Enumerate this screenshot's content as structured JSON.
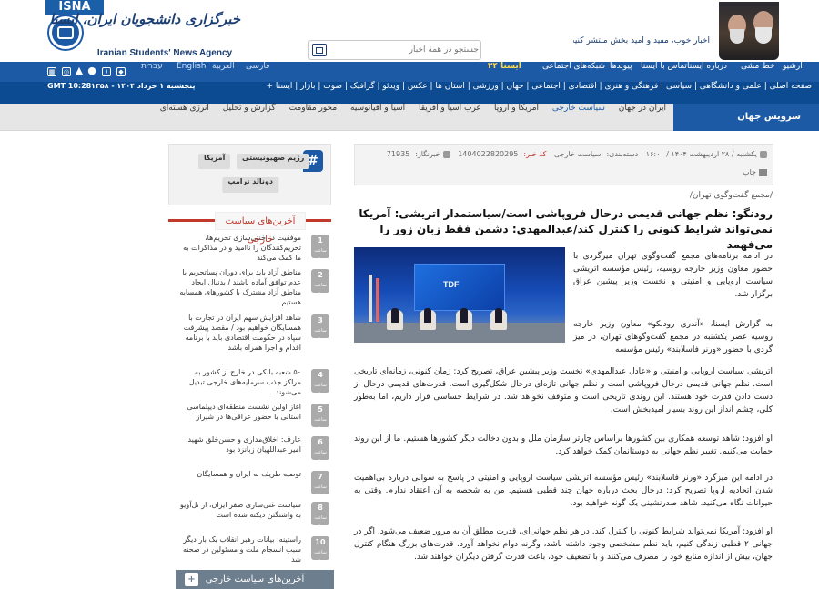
{
  "header": {
    "isna_label": "ISNA",
    "brand_fa": "خبرگزاری دانشجویان ایران، ایسنا",
    "brand_en": "Iranian Students' News Agency",
    "search_placeholder": "جستجو در همهٔ اخبار",
    "leader_text": "اخبار خوب، مفید و امید بخش منتشر کنید. رهبر معظم انقلاب"
  },
  "topnav": {
    "items": [
      "آرشیو",
      "خط مشی",
      "درباره ایسنا",
      "تماس با ایسنا",
      "پیوندها",
      "شبکه‌های اجتماعی"
    ],
    "isna24": "ایسنا ۲۴",
    "languages": [
      "فارسی",
      "العربية",
      "English",
      "עברית"
    ]
  },
  "subnav": {
    "links": "صفحه اصلی | علمی و دانشگاهی | سیاسی | فرهنگی و هنری | اقتصادی | اجتماعی | جهان | ورزشی | استان ها | عکس | ویدئو | گرافیک | صوت | بازار | ایسنا +",
    "date": "پنجشنبه ۱ خرداد ۱۴۰۴ - ۱۳۵۸",
    "gmt": "GMT 10:28"
  },
  "sectionbar": {
    "title": "سرویس جهان",
    "links": [
      "ایران در جهان",
      "سیاست خارجی",
      "آمریکا و اروپا",
      "غرب آسیا و آفریقا",
      "آسیا و اقیانوسیه",
      "محور مقاومت",
      "گزارش و تحلیل",
      "انرژی هسته‌ای"
    ]
  },
  "tags": [
    "رژیم صهیونیستی",
    "آمریکا",
    "دونالد ترامپ"
  ],
  "latest": {
    "title": "آخرین‌های سیاست خارجی",
    "num_label": "ساعت قبل",
    "items": [
      {
        "num": "1",
        "text": "موفقیت در خنثی‌سازی تحریم‌ها، تحریم‌کنندگان را ناامید و در مذاکرات به ما کمک می‌کند"
      },
      {
        "num": "2",
        "text": "مناطق آزاد باید برای دوران پساتحریم با عدم توافق آماده باشند / بدنبال ایجاد مناطق آزاد مشترک با کشورهای همسایه هستیم"
      },
      {
        "num": "3",
        "text": "شاهد افزایش سهم ایران در تجارت با همسایگان خواهیم بود / مقصد پیشرفت سپاه در حکومت اقتصادی باید با برنامه اقدام و اجرا همراه باشد"
      },
      {
        "num": "4",
        "text": "۵۰ شعبه بانکی در خارج از کشور به مراکز جذب سرمایه‌های خارجی تبدیل می‌شوند"
      },
      {
        "num": "5",
        "text": "اغاز اولین نشست منطقه‌ای دیپلماسی استانی با حضور عراقی‌ها در شیراز"
      },
      {
        "num": "6",
        "text": "عارف: اخلاق‌مداری و حسن‌خلق شهید امیر عبداللهیان زبانزد بود"
      },
      {
        "num": "7",
        "text": "توصیه ظریف به ایران و همسایگان"
      },
      {
        "num": "8",
        "text": "سیاست غنی‌سازی صفر ایران، از تل‌آویو به واشنگتن دیکته شده است"
      },
      {
        "num": "10",
        "text": "راستینه: بیانات رهبر انقلاب یک بار دیگر سبب انسجام ملت و مسئولین در صحنه شد"
      }
    ],
    "footer": "آخرین‌های سیاست خارجی"
  },
  "article": {
    "meta_date": "یکشنبه / ۲۸ اردیبهشت ۱۴۰۴ / ۱۶:۰۰",
    "meta_category_label": "دسته‌بندی:",
    "meta_category": "سیاست خارجی",
    "meta_code_label": "کد خبر:",
    "meta_code": "1404022820295",
    "meta_reporter_label": "خبرنگار:",
    "meta_reporter": "71935",
    "print_label": "چاپ",
    "breadcrumb": "/مجمع گفت‌وگوی تهران/",
    "headline": "رودنگو: نظم جهانی قدیمی درحال فروپاشی است/سیاستمدار اتریشی: آمریکا نمی‌تواند شرایط کنونی را کنترل کند/عبدالمهدی: دشمن فقط زبان زور را می‌فهمد",
    "photo_caption": "TDF",
    "paragraphs": [
      "در ادامه برنامه‌های مجمع گفت‌وگوی تهران میزگردی با حضور معاون وزیر خارجه روسیه، رئیس مؤسسه اتریشی سیاست اروپایی و امنیتی و نخست وزیر پیشین عراق برگزار شد.",
      "به گزارش ایسنا، «آندری رودنکو» معاون وزیر خارجه روسیه عصر یکشنبه در مجمع گفت‌وگوهای تهران، در میز گردی با حضور «ورنر فاسلابند» رئیس مؤسسه",
      "اتریشی سیاست اروپایی و امنیتی و «عادل عبدالمهدی» نخست وزیر پیشین عراق، تصریح کرد: زمان کنونی، زمانه‌ای تاریخی است. نظم جهانی قدیمی درحال فروپاشی است و نظم جهانی تازه‌ای درحال شکل‌گیری است. قدرت‌های قدیمی درحال از دست دادن قدرت خود هستند. این روندی تاریخی است و متوقف نخواهد شد. در شرایط حساسی قرار داریم، اما به‌طور کلی، چشم انداز این روند بسیار امیدبخش است.",
      "او افزود: شاهد توسعه همکاری بین کشورها براساس چارتر سازمان ملل و بدون دخالت دیگر کشورها هستیم. ما از این روند حمایت می‌کنیم. تغییر نظم جهانی به دوستانمان کمک خواهد کرد.",
      "در ادامه این میزگرد «ورنر فاسلابند» رئیس مؤسسه اتریشی سیاست اروپایی و امنیتی در پاسخ به سوالی درباره بی‌اهمیت شدن اتحادیه اروپا تصریح کرد: درحال بحث درباره جهان چند قطبی هستیم. من به شخصه به آن اعتقاد ندارم. وقتی به حیوانات نگاه می‌کنید، شاهد صدرنشینی یک گونه خواهید بود.",
      "او افزود: آمریکا نمی‌تواند شرایط کنونی را کنترل کند. در هر نظم جهانی‌ای، قدرت مطلق آن به مرور ضعیف می‌شود. اگر در جهانی ۲ قطبی زندگی کنیم، باید نظم مشخصی وجود داشته باشد، وگرنه دوام نخواهد آورد. قدرت‌های بزرگ هنگام کنترل جهان، بیش از اندازه منابع خود را مصرف می‌کنند و با تضعیف خود، باعث قدرت گرفتن دیگران خواهند شد."
    ]
  }
}
